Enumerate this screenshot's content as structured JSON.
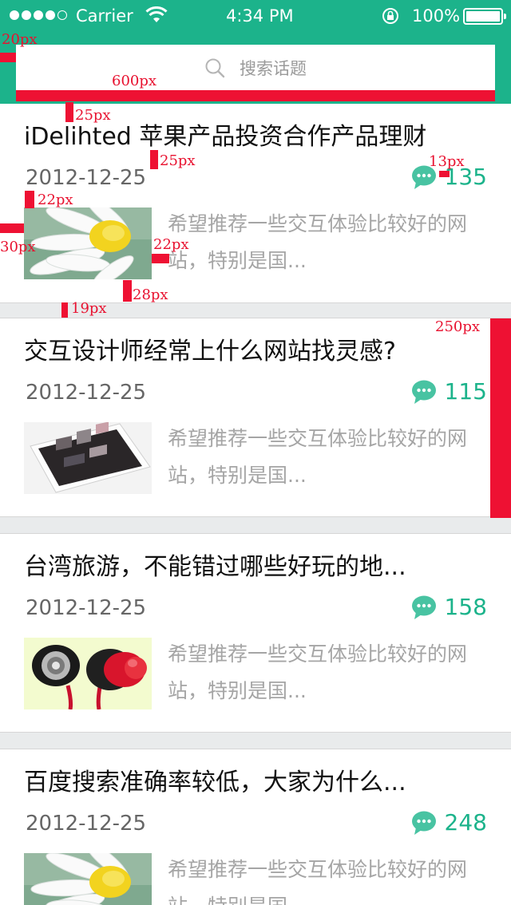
{
  "status_bar": {
    "carrier": "Carrier",
    "time": "4:34 PM",
    "battery": "100%",
    "icons": [
      "signal-dots-icon",
      "wifi-icon",
      "rotation-lock-icon",
      "battery-icon"
    ]
  },
  "search": {
    "placeholder": "搜索话题",
    "icon": "search-icon"
  },
  "colors": {
    "brand": "#1cb38b",
    "title": "#111111",
    "date": "#666666",
    "desc": "#a5a5a5",
    "annotation": "#ee1133",
    "background": "#e9ebec"
  },
  "topics": [
    {
      "title": "iDelihted 苹果产品投资合作产品理财",
      "date": "2012-12-25",
      "comments": "135",
      "thumbnail": "daisy-flower-image",
      "description": "希望推荐一些交互体验比较好的网站，特别是国..."
    },
    {
      "title": "交互设计师经常上什么网站找灵感?",
      "date": "2012-12-25",
      "comments": "115",
      "thumbnail": "tablet-website-image",
      "description": "希望推荐一些交互体验比较好的网站，特别是国..."
    },
    {
      "title": "台湾旅游，不能错过哪些好玩的地...",
      "date": "2012-12-25",
      "comments": "158",
      "thumbnail": "red-earphones-image",
      "description": "希望推荐一些交互体验比较好的网站，特别是国..."
    },
    {
      "title": "百度搜索准确率较低，大家为什么...",
      "date": "2012-12-25",
      "comments": "248",
      "thumbnail": "daisy-flower-image",
      "description": "希望推荐一些交互体验比较好的网站，特别是国..."
    }
  ],
  "annotations": [
    "20px",
    "600px",
    "25px",
    "25px",
    "13px",
    "22px",
    "30px",
    "22px",
    "28px",
    "19px",
    "250px"
  ]
}
